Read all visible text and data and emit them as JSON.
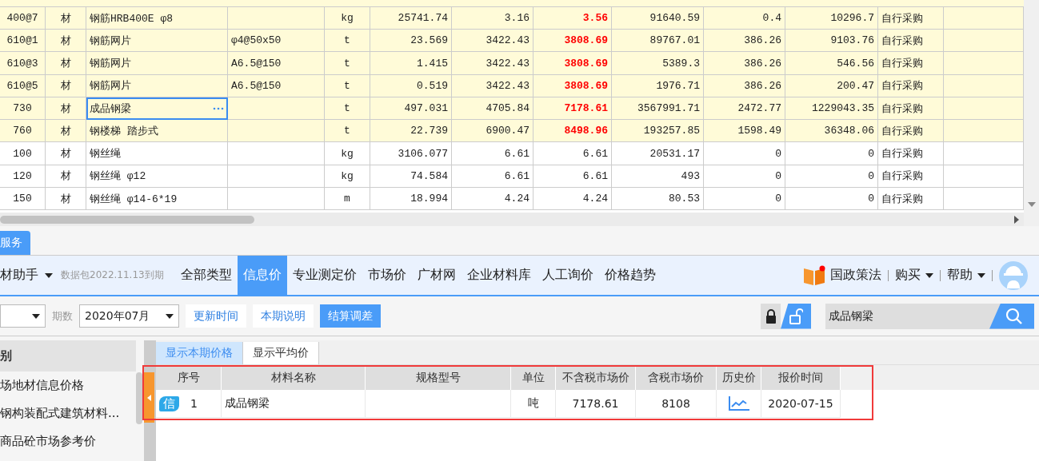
{
  "grid": {
    "rows": [
      {
        "highlighted": true,
        "editing": false,
        "cells": [
          "400@7",
          "材",
          "钢筋HRB400E φ8",
          "",
          "kg",
          "25741.74",
          "3.16",
          "3.56",
          "91640.59",
          "0.4",
          "10296.7",
          "自行采购"
        ]
      },
      {
        "highlighted": true,
        "editing": false,
        "cells": [
          "610@1",
          "材",
          "钢筋网片",
          "φ4@50x50",
          "t",
          "23.569",
          "3422.43",
          "3808.69",
          "89767.01",
          "386.26",
          "9103.76",
          "自行采购"
        ]
      },
      {
        "highlighted": true,
        "editing": false,
        "cells": [
          "610@3",
          "材",
          "钢筋网片",
          "A6.5@150",
          "t",
          "1.415",
          "3422.43",
          "3808.69",
          "5389.3",
          "386.26",
          "546.56",
          "自行采购"
        ]
      },
      {
        "highlighted": true,
        "editing": false,
        "cells": [
          "610@5",
          "材",
          "钢筋网片",
          "A6.5@150",
          "t",
          "0.519",
          "3422.43",
          "3808.69",
          "1976.71",
          "386.26",
          "200.47",
          "自行采购"
        ]
      },
      {
        "highlighted": true,
        "editing": true,
        "cells": [
          "730",
          "材",
          "成品钢梁",
          "",
          "t",
          "497.031",
          "4705.84",
          "7178.61",
          "3567991.71",
          "2472.77",
          "1229043.35",
          "自行采购"
        ]
      },
      {
        "highlighted": true,
        "editing": false,
        "cells": [
          "760",
          "材",
          "钢楼梯 踏步式",
          "",
          "t",
          "22.739",
          "6900.47",
          "8498.96",
          "193257.85",
          "1598.49",
          "36348.06",
          "自行采购"
        ]
      },
      {
        "highlighted": false,
        "editing": false,
        "cells": [
          "100",
          "材",
          "钢丝绳",
          "",
          "kg",
          "3106.077",
          "6.61",
          "6.61",
          "20531.17",
          "0",
          "0",
          "自行采购"
        ]
      },
      {
        "highlighted": false,
        "editing": false,
        "cells": [
          "120",
          "材",
          "钢丝绳 φ12",
          "",
          "kg",
          "74.584",
          "6.61",
          "6.61",
          "493",
          "0",
          "0",
          "自行采购"
        ]
      },
      {
        "highlighted": false,
        "editing": false,
        "cells": [
          "150",
          "材",
          "钢丝绳 φ14-6*19",
          "",
          "m",
          "18.994",
          "4.24",
          "4.24",
          "80.53",
          "0",
          "0",
          "自行采购"
        ]
      }
    ]
  },
  "panel_tab": "服务",
  "toolbar": {
    "assistant": "材助手",
    "package_note": "数据包2022.11.13到期",
    "tabs": [
      {
        "label": "全部类型",
        "selected": false
      },
      {
        "label": "信息价",
        "selected": true
      },
      {
        "label": "专业测定价",
        "selected": false
      },
      {
        "label": "市场价",
        "selected": false
      },
      {
        "label": "广材网",
        "selected": false
      },
      {
        "label": "企业材料库",
        "selected": false
      },
      {
        "label": "人工询价",
        "selected": false
      },
      {
        "label": "价格趋势",
        "selected": false
      }
    ],
    "policy": "国政策法",
    "buy": "购买",
    "help": "帮助"
  },
  "filters": {
    "period_label": "期数",
    "period": "2020年07月",
    "buttons": [
      {
        "label": "更新时间",
        "selected": false
      },
      {
        "label": "本期说明",
        "selected": false
      },
      {
        "label": "结算调差",
        "selected": true
      }
    ],
    "search": "成品钢梁"
  },
  "sidebar": {
    "header": "别",
    "items": [
      {
        "label": "场地材信息价格"
      },
      {
        "label": "钢构装配式建筑材料..."
      },
      {
        "label": "商品砼市场参考价"
      }
    ]
  },
  "view_tabs": [
    {
      "label": "显示本期价格",
      "selected": true
    },
    {
      "label": "显示平均价",
      "selected": false
    }
  ],
  "results": {
    "columns": [
      "序号",
      "材料名称",
      "规格型号",
      "单位",
      "不含税市场价",
      "含税市场价",
      "历史价",
      "报价时间"
    ],
    "rows": [
      {
        "badge": "信",
        "index": "1",
        "name": "成品钢梁",
        "spec": "",
        "unit": "吨",
        "price_ex_tax": "7178.61",
        "price_tax": "8108",
        "date": "2020-07-15"
      }
    ]
  }
}
